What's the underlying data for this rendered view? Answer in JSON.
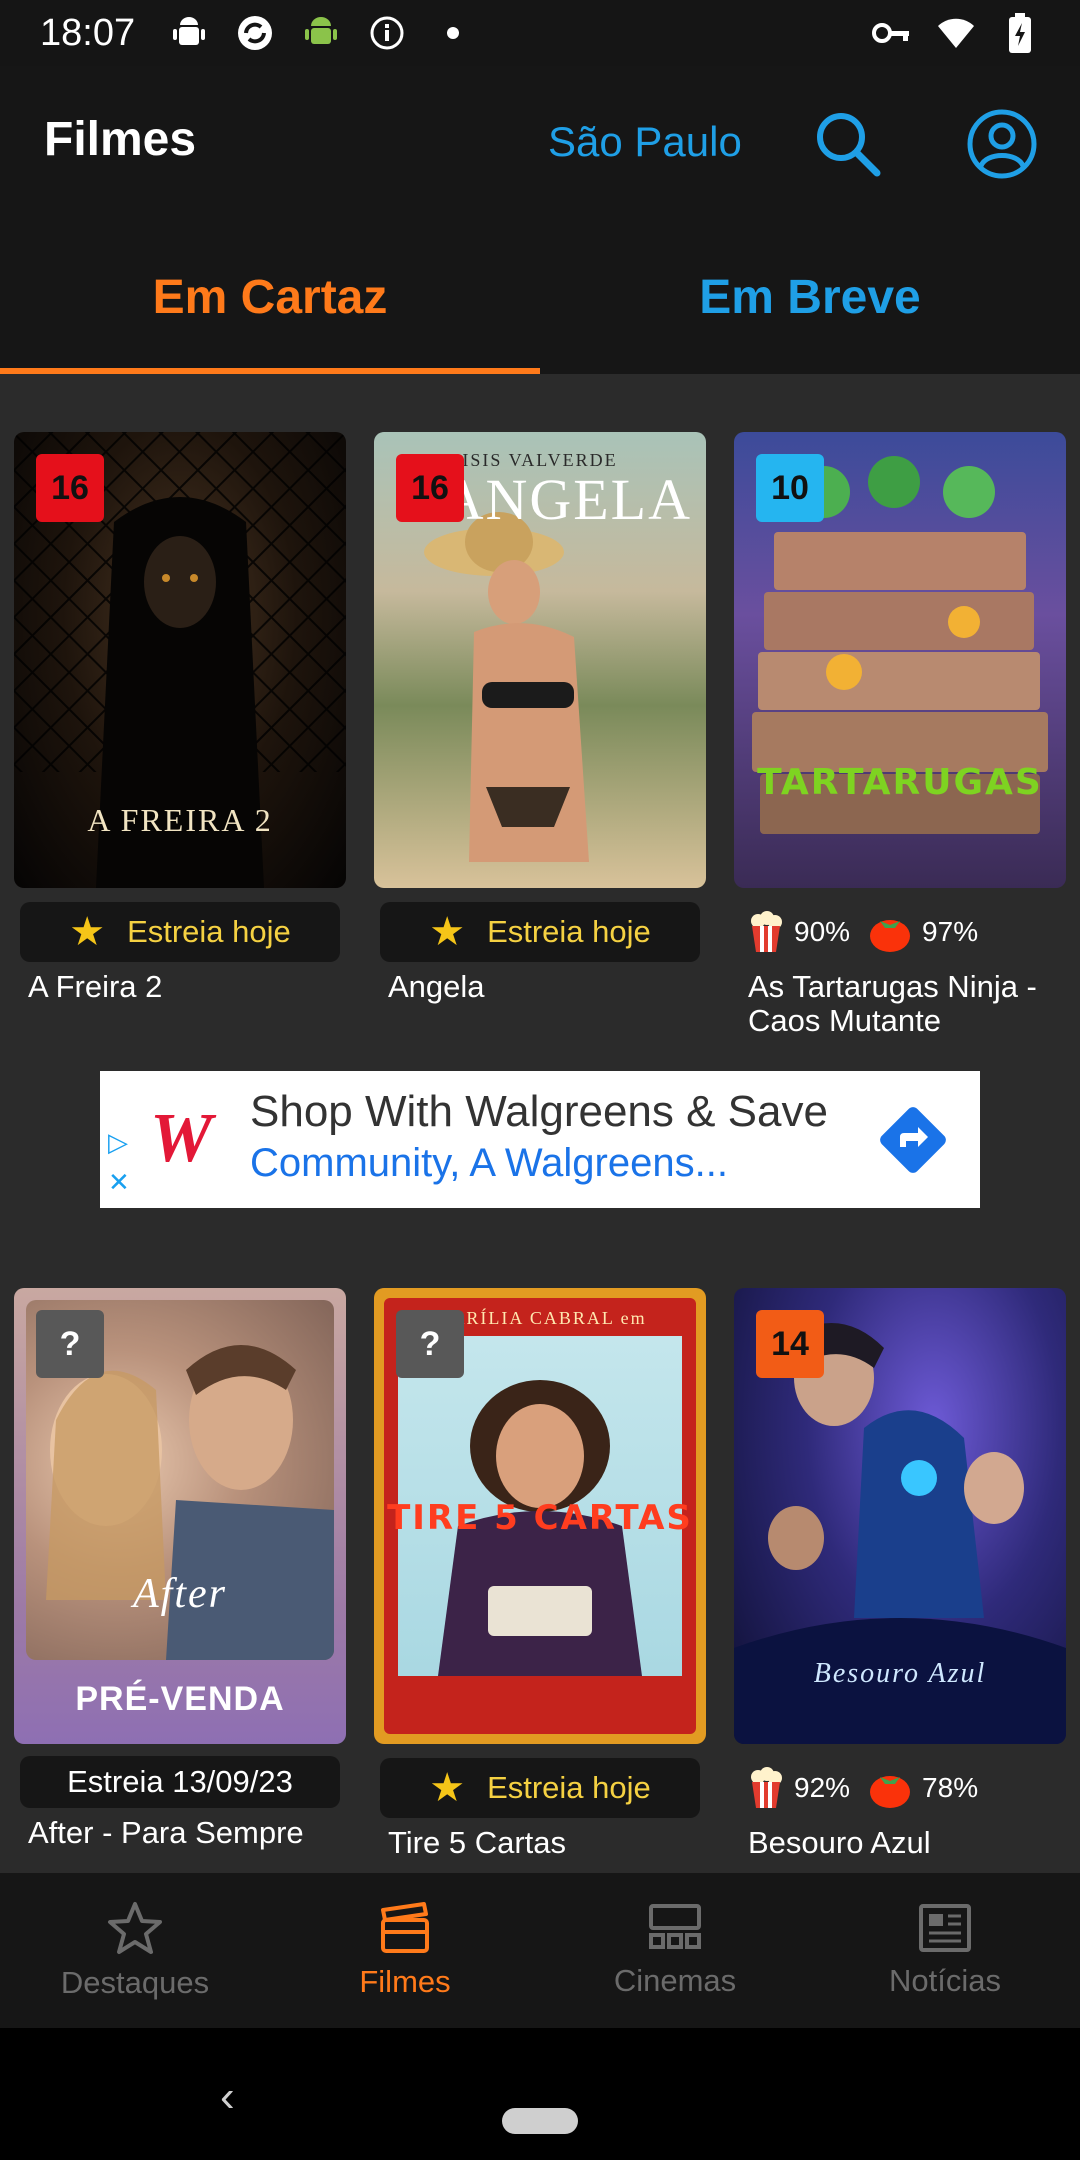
{
  "status_bar": {
    "time": "18:07"
  },
  "header": {
    "title": "Filmes",
    "city": "São Paulo"
  },
  "tabs": [
    {
      "label": "Em Cartaz",
      "active": true
    },
    {
      "label": "Em Breve",
      "active": false
    }
  ],
  "movies": [
    {
      "name": "A Freira 2",
      "rating": "16",
      "badge": "Estreia hoje",
      "poster_text": "A FREIRA 2"
    },
    {
      "name": "Angela",
      "rating": "16",
      "badge": "Estreia hoje",
      "poster_text": "ANGELA",
      "poster_top": "ISIS VALVERDE"
    },
    {
      "name": "As Tartarugas Ninja - Caos Mutante",
      "rating": "10",
      "popcorn": "90%",
      "tomato": "97%"
    },
    {
      "name": "After - Para Sempre",
      "rating": "?",
      "badge": "Estreia 13/09/23",
      "presale": "PRÉ-VENDA"
    },
    {
      "name": "Tire 5 Cartas",
      "rating": "?",
      "badge": "Estreia hoje",
      "poster_text": "TIRE 5 CARTAS",
      "poster_top": "MARÍLIA CABRAL em"
    },
    {
      "name": "Besouro Azul",
      "rating": "14",
      "popcorn": "92%",
      "tomato": "78%"
    }
  ],
  "ad": {
    "headline": "Shop With Walgreens & Save",
    "subline": "Community, A Walgreens...",
    "logo": "W"
  },
  "bottom_nav": [
    {
      "label": "Destaques",
      "icon": "star-icon"
    },
    {
      "label": "Filmes",
      "icon": "clapperboard-icon",
      "active": true
    },
    {
      "label": "Cinemas",
      "icon": "cinema-seats-icon"
    },
    {
      "label": "Notícias",
      "icon": "newspaper-icon"
    }
  ],
  "colors": {
    "accent": "#ff7a1a",
    "link": "#1f9fe6",
    "badge_text": "#f5d142"
  }
}
